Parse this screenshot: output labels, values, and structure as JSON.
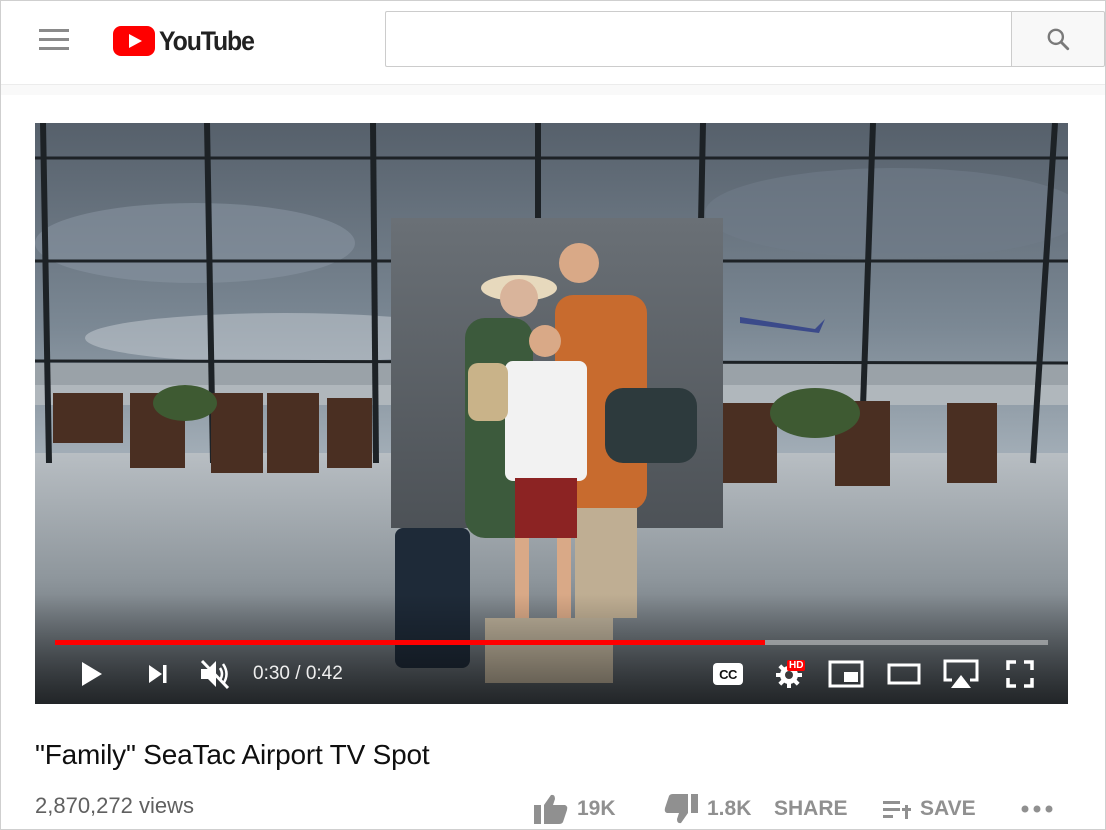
{
  "app": {
    "brand": "YouTube"
  },
  "search": {
    "placeholder": ""
  },
  "player": {
    "current_time": "0:30",
    "separator": " / ",
    "duration": "0:42",
    "progress_fraction": 0.715,
    "muted": true,
    "settings_badge": "HD",
    "cc_label": "CC"
  },
  "video": {
    "title": "\"Family\" SeaTac Airport TV Spot",
    "views": "2,870,272 views",
    "likes": "19K",
    "dislikes": "1.8K",
    "share_label": "SHARE",
    "save_label": "SAVE"
  },
  "colors": {
    "brand_red": "#ff0000",
    "action_gray": "#909090"
  },
  "icons": [
    "menu-icon",
    "youtube-logo",
    "search-icon",
    "play-icon",
    "next-icon",
    "volume-muted-icon",
    "captions-icon",
    "settings-icon",
    "miniplayer-icon",
    "theater-icon",
    "airplay-icon",
    "fullscreen-icon",
    "thumbs-up-icon",
    "thumbs-down-icon",
    "share-icon",
    "playlist-add-icon",
    "more-icon"
  ]
}
